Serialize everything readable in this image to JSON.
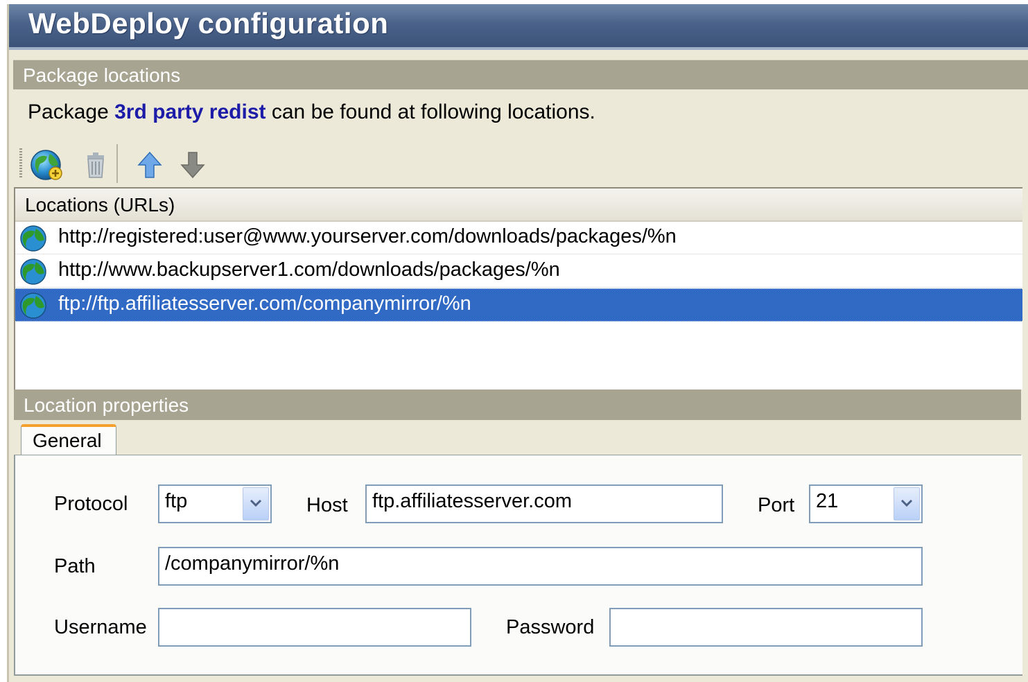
{
  "window": {
    "title": "WebDeploy configuration"
  },
  "package_locations": {
    "header": "Package locations",
    "description_prefix": "Package",
    "package_name": "3rd party redist",
    "description_suffix": "can be found at following locations."
  },
  "toolbar": {
    "icons": [
      "add-location-icon",
      "delete-icon",
      "move-up-icon",
      "move-down-icon"
    ]
  },
  "locations": {
    "column_header": "Locations (URLs)",
    "rows": [
      {
        "url": "http://registered:user@www.yourserver.com/downloads/packages/%n",
        "selected": false
      },
      {
        "url": "http://www.backupserver1.com/downloads/packages/%n",
        "selected": false
      },
      {
        "url": "ftp://ftp.affiliatesserver.com/companymirror/%n",
        "selected": true
      }
    ]
  },
  "location_properties": {
    "header": "Location properties",
    "tab": "General",
    "protocol_label": "Protocol",
    "protocol_value": "ftp",
    "host_label": "Host",
    "host_value": "ftp.affiliatesserver.com",
    "port_label": "Port",
    "port_value": "21",
    "path_label": "Path",
    "path_value": "/companymirror/%n",
    "username_label": "Username",
    "username_value": "",
    "password_label": "Password",
    "password_value": ""
  },
  "colors": {
    "title_bar": "#4a6289",
    "section_header": "#a8a492",
    "selection": "#316ac5",
    "package_name": "#1c1ca8",
    "active_tab_accent": "#f5a02c"
  }
}
